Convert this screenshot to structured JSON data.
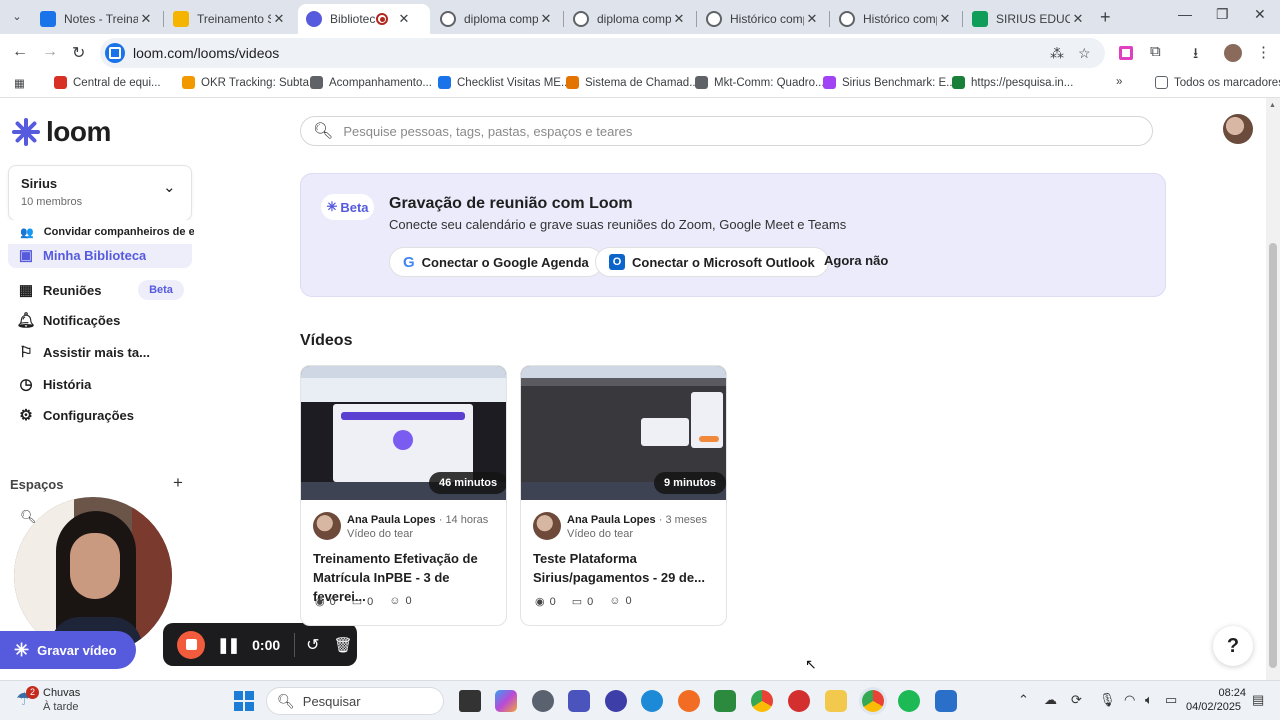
{
  "browser": {
    "tabs": [
      {
        "title": "Notes - Treinamento",
        "active": false,
        "favicon_color": "#1a73e8"
      },
      {
        "title": "Treinamento Sec",
        "active": false,
        "favicon_color": "#f4b400"
      },
      {
        "title": "Biblioteca | Loom",
        "active": true,
        "favicon_color": "#565add"
      },
      {
        "title": "diploma complet",
        "active": false,
        "favicon_color": "#5f6368"
      },
      {
        "title": "diploma complet",
        "active": false,
        "favicon_color": "#5f6368"
      },
      {
        "title": "Histórico compl",
        "active": false,
        "favicon_color": "#5f6368"
      },
      {
        "title": "Histórico compl",
        "active": false,
        "favicon_color": "#5f6368"
      },
      {
        "title": "SIRIUS EDUCACI",
        "active": false,
        "favicon_color": "#0f9d58"
      }
    ],
    "url": "loom.com/looms/videos",
    "bookmarks": [
      {
        "label": "Central de equi...",
        "color": "#d93025"
      },
      {
        "label": "OKR Tracking: Subta...",
        "color": "#f29900"
      },
      {
        "label": "Acompanhamento...",
        "color": "#5f6368"
      },
      {
        "label": "Checklist Visitas ME...",
        "color": "#1a73e8"
      },
      {
        "label": "Sistema de Chamad...",
        "color": "#e37400"
      },
      {
        "label": "Mkt-Comm: Quadro...",
        "color": "#5f6368"
      },
      {
        "label": "Sirius Benchmark: E...",
        "color": "#a142f4"
      },
      {
        "label": "https://pesquisa.in...",
        "color": "#188038"
      }
    ],
    "all_bookmarks": "Todos os marcadores"
  },
  "loom": {
    "logo": "loom",
    "workspace": {
      "name": "Sirius",
      "members": "10 membros"
    },
    "invite": "Convidar companheiros de equipe",
    "nav": [
      {
        "label": "Minha Biblioteca",
        "icon": "library-icon"
      },
      {
        "label": "Reuniões",
        "icon": "calendar-icon",
        "badge": "Beta"
      },
      {
        "label": "Notificações",
        "icon": "bell-icon"
      },
      {
        "label": "Assistir mais ta...",
        "icon": "bookmark-icon"
      },
      {
        "label": "História",
        "icon": "clock-icon"
      },
      {
        "label": "Configurações",
        "icon": "gear-icon"
      }
    ],
    "spaces_label": "Espaços",
    "record_button": "Gravar vídeo",
    "recording": {
      "time": "0:00"
    },
    "search_placeholder": "Pesquise pessoas, tags, pastas, espaços e teares",
    "banner": {
      "badge": "Beta",
      "title": "Gravação de reunião com Loom",
      "description": "Conecte seu calendário e grave suas reuniões do Zoom, Google Meet e Teams",
      "google_button": "Conectar o Google Agenda",
      "outlook_button": "Conectar o Microsoft Outlook",
      "dismiss": "Agora não"
    },
    "videos_heading": "Vídeos",
    "videos": [
      {
        "duration": "46 minutos",
        "author": "Ana Paula Lopes",
        "time": "14 horas",
        "type": "Vídeo do tear",
        "title": "Treinamento Efetivação de Matrícula InPBE - 3 de feverei...",
        "views": "0",
        "comments": "0",
        "reactions": "0"
      },
      {
        "duration": "9 minutos",
        "author": "Ana Paula Lopes",
        "time": "3 meses",
        "type": "Vídeo do tear",
        "title": "Teste Plataforma Sirius/pagamentos - 29 de...",
        "views": "0",
        "comments": "0",
        "reactions": "0"
      }
    ],
    "help": "?"
  },
  "taskbar": {
    "weather": {
      "badge": "2",
      "line1": "Chuvas",
      "line2": "À tarde"
    },
    "search": "Pesquisar",
    "time": "08:24",
    "date": "04/02/2025"
  }
}
